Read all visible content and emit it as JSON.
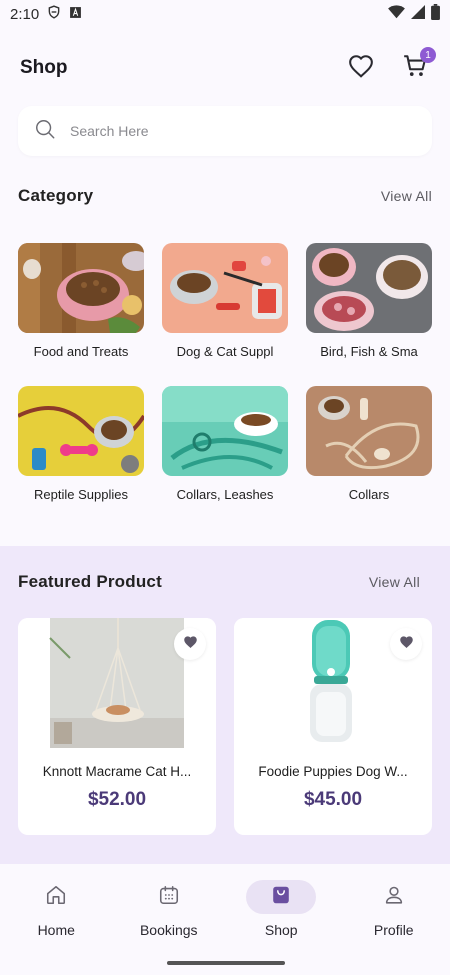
{
  "status": {
    "time": "2:10"
  },
  "header": {
    "title": "Shop",
    "cart_count": "1"
  },
  "search": {
    "placeholder": "Search Here"
  },
  "category": {
    "title": "Category",
    "view_all": "View All",
    "items": [
      {
        "label": "Food and Treats"
      },
      {
        "label": "Dog & Cat Suppl"
      },
      {
        "label": "Bird, Fish & Sma"
      },
      {
        "label": "Reptile Supplies"
      },
      {
        "label": "Collars, Leashes"
      },
      {
        "label": "Collars"
      }
    ]
  },
  "featured": {
    "title": "Featured Product",
    "view_all": "View All",
    "products": [
      {
        "name": "Knnott Macrame Cat H...",
        "price": "$52.00"
      },
      {
        "name": "Foodie Puppies Dog W...",
        "price": "$45.00"
      }
    ]
  },
  "nav": {
    "items": [
      {
        "label": "Home",
        "icon": "home-icon"
      },
      {
        "label": "Bookings",
        "icon": "calendar-icon"
      },
      {
        "label": "Shop",
        "icon": "shopping-bag-icon"
      },
      {
        "label": "Profile",
        "icon": "person-icon"
      }
    ],
    "active": "Shop"
  },
  "colors": {
    "accent": "#8e5bd3",
    "price": "#4b3a78",
    "featured_bg": "#efe8fa",
    "active_nav": "#e9e2f4"
  }
}
